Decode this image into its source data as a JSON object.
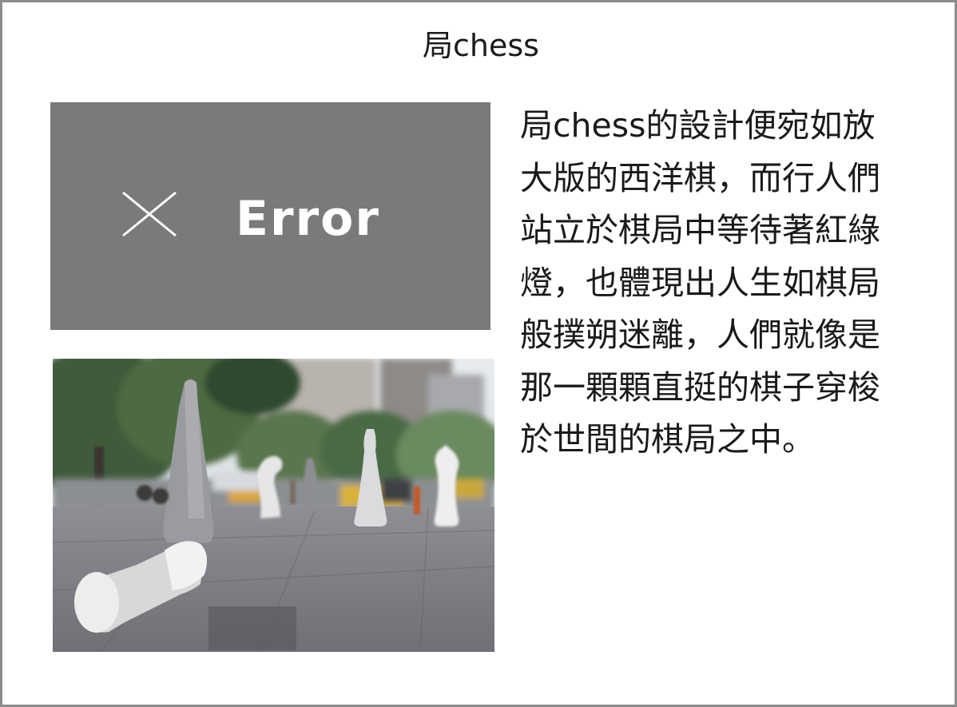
{
  "title": "局chess",
  "error_panel": {
    "icon": "close-icon",
    "label": "Error",
    "background": "#7a7a7a"
  },
  "photo": {
    "description_icon": "chess-sculptures-photo"
  },
  "body_lines": [
    "局chess的設計便宛如放",
    "大版的西洋棋，而行人們",
    "站立於棋局中等待著紅綠",
    "燈，也體現出人生如棋局",
    "般撲朔迷離，人們就像是",
    "那一顆顆直挺的棋子穿梭",
    "於世間的棋局之中。"
  ]
}
